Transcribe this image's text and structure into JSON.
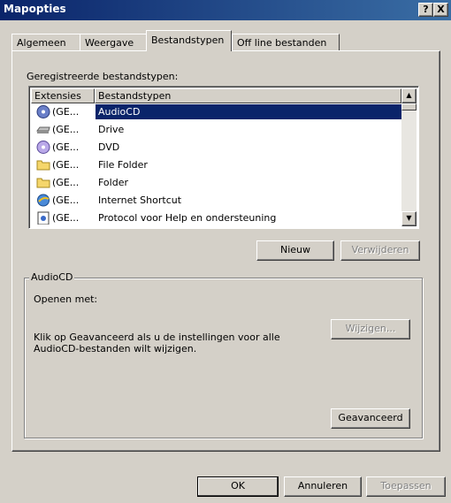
{
  "window": {
    "title": "Mapopties",
    "help_btn": "?",
    "close_btn": "X"
  },
  "tabs": [
    {
      "label": "Algemeen"
    },
    {
      "label": "Weergave"
    },
    {
      "label": "Bestandstypen"
    },
    {
      "label": "Off line bestanden"
    }
  ],
  "file_types": {
    "label": "Geregistreerde bestandstypen:",
    "columns": [
      "Extensies",
      "Bestandstypen"
    ],
    "rows": [
      {
        "ext": "(GE...",
        "type": "AudioCD",
        "icon": "audiocd-icon"
      },
      {
        "ext": "(GE...",
        "type": "Drive",
        "icon": "drive-icon"
      },
      {
        "ext": "(GE...",
        "type": "DVD",
        "icon": "dvd-icon"
      },
      {
        "ext": "(GE...",
        "type": "File Folder",
        "icon": "folder-icon"
      },
      {
        "ext": "(GE...",
        "type": "Folder",
        "icon": "folder-icon"
      },
      {
        "ext": "(GE...",
        "type": "Internet Shortcut",
        "icon": "internet-shortcut-icon"
      },
      {
        "ext": "(GE...",
        "type": "Protocol voor Help en ondersteuning",
        "icon": "help-protocol-icon"
      }
    ]
  },
  "list_buttons": {
    "new": "Nieuw",
    "delete": "Verwijderen"
  },
  "details": {
    "group_title": "AudioCD",
    "opens_with": "Openen met:",
    "change": "Wijzigen...",
    "advanced_text_1": "Klik op Geavanceerd als u de instellingen voor alle",
    "advanced_text_2": "AudioCD-bestanden wilt wijzigen.",
    "advanced": "Geavanceerd"
  },
  "footer": {
    "ok": "OK",
    "cancel": "Annuleren",
    "apply": "Toepassen"
  },
  "colors": {
    "title_bar": "#0a246a",
    "selection": "#0a246a",
    "face": "#d4d0c8"
  }
}
